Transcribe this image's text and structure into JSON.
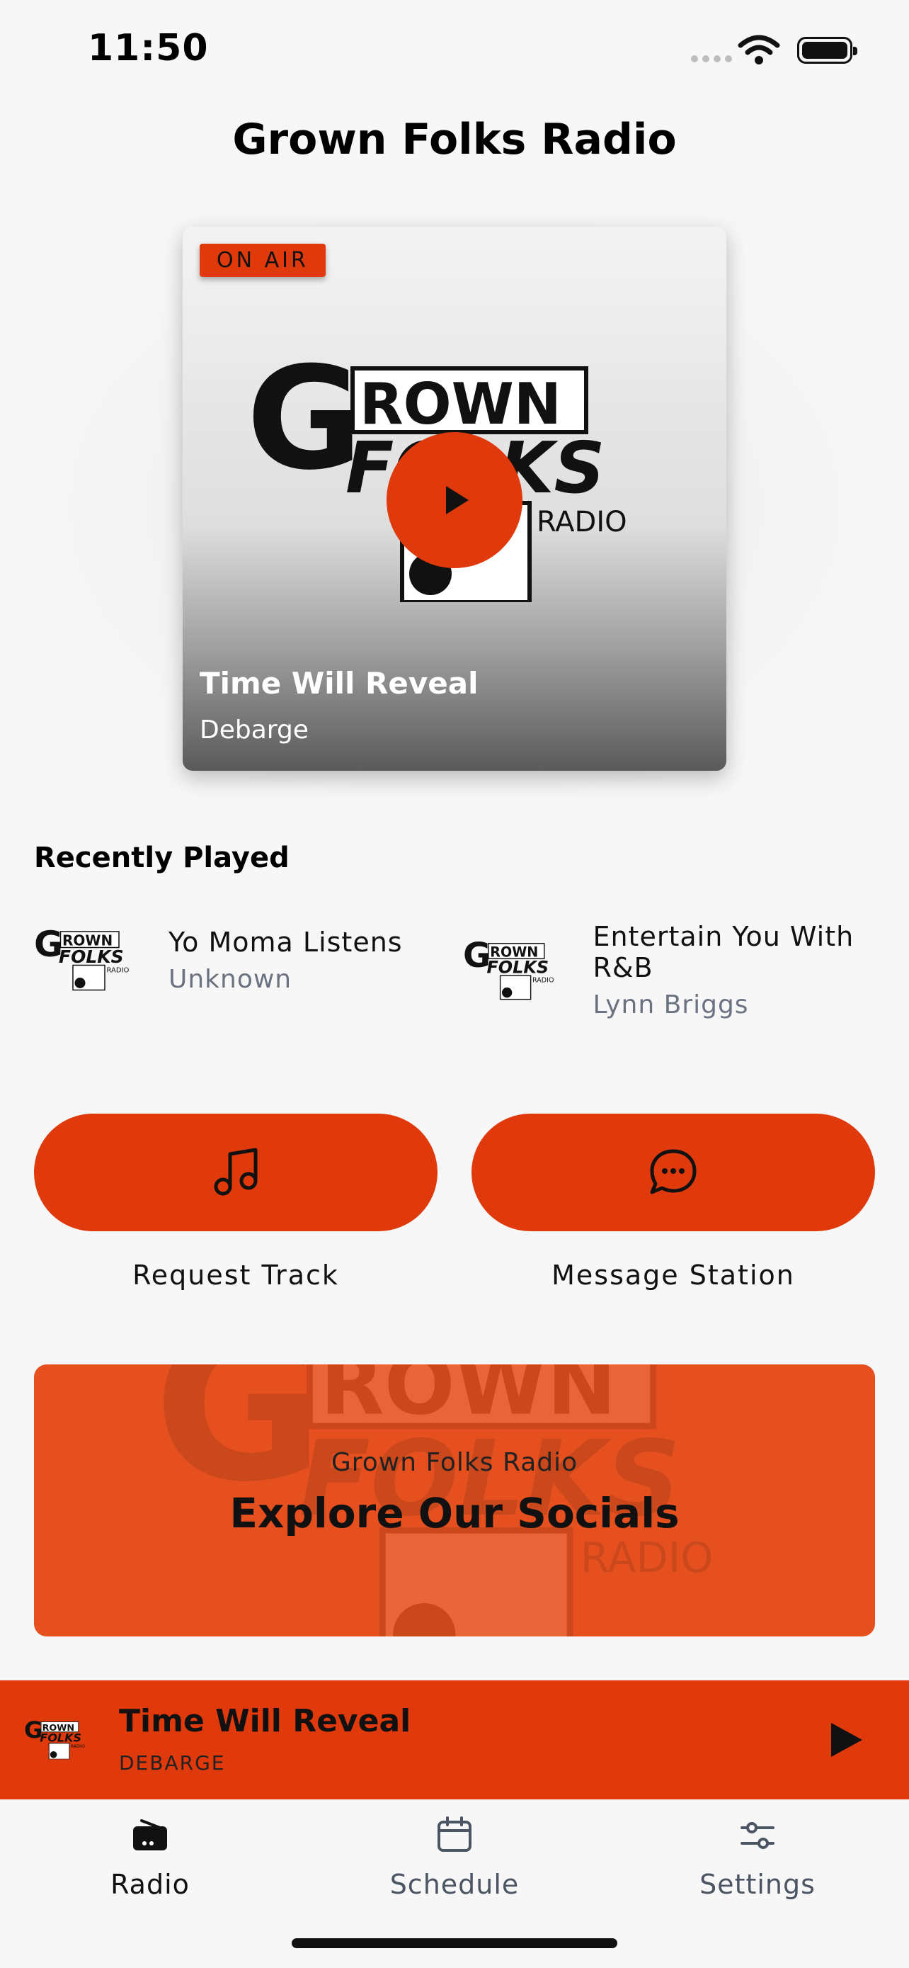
{
  "status_bar": {
    "time": "11:50"
  },
  "app": {
    "title": "Grown Folks Radio"
  },
  "hero": {
    "badge": "ON AIR",
    "track_title": "Time Will Reveal",
    "track_artist": "Debarge",
    "logo_icon": "grown-folks-radio-logo",
    "play_icon": "play-icon"
  },
  "recently_played": {
    "title": "Recently Played",
    "items": [
      {
        "title": "Yo Moma Listens",
        "artist": "Unknown"
      },
      {
        "title": "Entertain You With R&B",
        "artist": "Lynn Briggs"
      }
    ]
  },
  "actions": [
    {
      "label": "Request Track",
      "icon": "music-note-icon"
    },
    {
      "label": "Message Station",
      "icon": "chat-bubble-icon"
    }
  ],
  "socials": {
    "subtitle": "Grown Folks Radio",
    "title": "Explore Our Socials"
  },
  "mini_player": {
    "title": "Time Will Reveal",
    "artist": "DEBARGE"
  },
  "tabs": [
    {
      "label": "Radio",
      "icon": "radio-icon",
      "active": true
    },
    {
      "label": "Schedule",
      "icon": "calendar-icon",
      "active": false
    },
    {
      "label": "Settings",
      "icon": "sliders-icon",
      "active": false
    }
  ],
  "colors": {
    "accent": "#e0390c",
    "background": "#f7f7f7",
    "muted_text": "#6b7280"
  }
}
